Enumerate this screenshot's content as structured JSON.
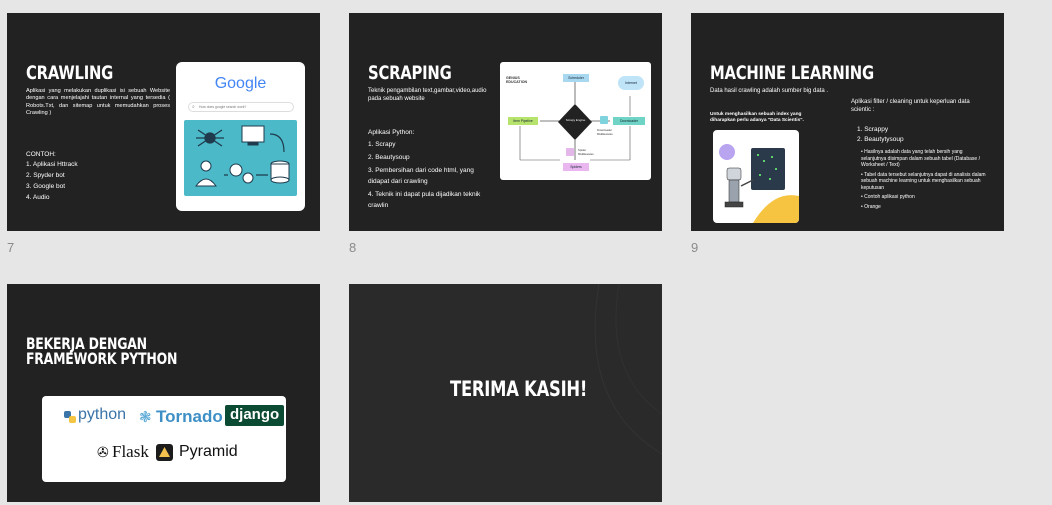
{
  "colors": {
    "background": "#e6e6e6",
    "slide": "#222222",
    "accent_teal": "#4bb9c8",
    "accent_yellow": "#f6c441"
  },
  "slides": [
    {
      "number": "7",
      "title": "CRAWLING",
      "body": "Aplikasi yang melakukan duplikasi isi sebuah Website dengan cara menjelajahi tautan internal yang tersedia ( Robots.Txt, dan sitemap untuk memudahkan proses Crawling )",
      "list_heading": "CONTOH:",
      "items": [
        "1. Aplikasi Httrack",
        "2. Spyder bot",
        "3. Google bot",
        "4. Audio"
      ],
      "image": {
        "logo": "Google",
        "search_placeholder": "How does google search work?"
      }
    },
    {
      "number": "8",
      "title": "SCRAPING",
      "subtitle": "Teknik pengambilan text,gambar,video,audio pada sebuah website",
      "list_heading": "Aplikasi Python:",
      "items": [
        "1. Scrapy",
        "2. Beautysoup",
        "3. Pembersihan dari code html, yang didapat dari crawling",
        "4. Teknik ini dapat pula dijadikan teknik crawlin"
      ],
      "diagram": {
        "brand": "GENIUS EDUCATION",
        "scheduler": "Scheduler",
        "internet": "Internet",
        "engine": "Scrapy Engine",
        "item_pipeline": "Item Pipeline",
        "downloader": "Downloader",
        "spiders": "Spiders",
        "mw1": "Spider Middlewares",
        "mw2": "Downloader Middlewares"
      }
    },
    {
      "number": "9",
      "title": "MACHINE LEARNING",
      "subtitle": "Data hasil crawling adalah sumber big data .",
      "left_note": "Untuk menghasilkan sebuah index yang diharapkan perlu adanya \"Data Scientis\".",
      "right_heading": "Aplikasi filter / cleaning untuk keperluan data scientic :",
      "items": [
        "1. Scrappy",
        "2. Beautytysoup"
      ],
      "bullets": [
        "Hasilnya adalah data yang telah bersih yang selanjutnya disimpan dalam sebuah tabel (Database / Worksheet / Text)",
        "Tabel data tersebut selanjutnya dapat di analisis dalam sebuah machine learning untuk menghasilkan sebuah keputusan",
        "Contoh aplikasi python",
        "Orange"
      ]
    },
    {
      "number": "",
      "title": "BEKERJA DENGAN FRAMEWORK PYTHON",
      "logos": {
        "python": "python",
        "tornado": "Tornado",
        "django": "django",
        "flask": "Flask",
        "pyramid": "Pyramid"
      }
    },
    {
      "number": "",
      "title": "TERIMA KASIH!"
    }
  ]
}
